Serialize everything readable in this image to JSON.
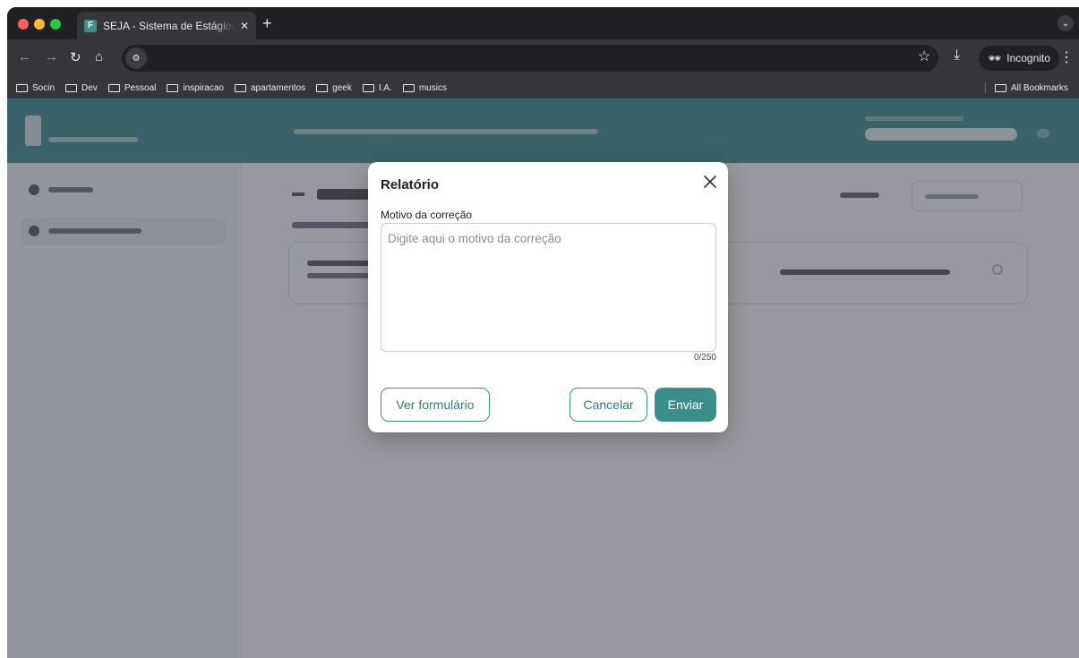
{
  "browser": {
    "tab_title": "SEJA - Sistema de Estágios e",
    "tab_favicon": "F",
    "new_tab_label": "+",
    "incognito_label": "Incognito",
    "bookmarks": [
      "Socin",
      "Dev",
      "Pessoal",
      "inspiracao",
      "apartamentos",
      "geek",
      "I.A.",
      "musics"
    ],
    "all_bookmarks_label": "All Bookmarks",
    "icons": [
      "back-icon",
      "forward-icon",
      "reload-icon",
      "home-icon",
      "site-info-icon",
      "star-icon",
      "download-icon",
      "incognito-icon",
      "kebab-menu-icon",
      "folder-icon"
    ]
  },
  "modal": {
    "title": "Relatório",
    "field_label": "Motivo da correção",
    "textarea_placeholder": "Digite aqui o motivo da correção",
    "textarea_value": "",
    "counter": "0/250",
    "view_form_button": "Ver formulário",
    "cancel_button": "Cancelar",
    "submit_button": "Enviar"
  },
  "colors": {
    "brand_teal": "#3a8f8a",
    "browser_dark": "#202124",
    "browser_toolbar": "#35363a"
  }
}
